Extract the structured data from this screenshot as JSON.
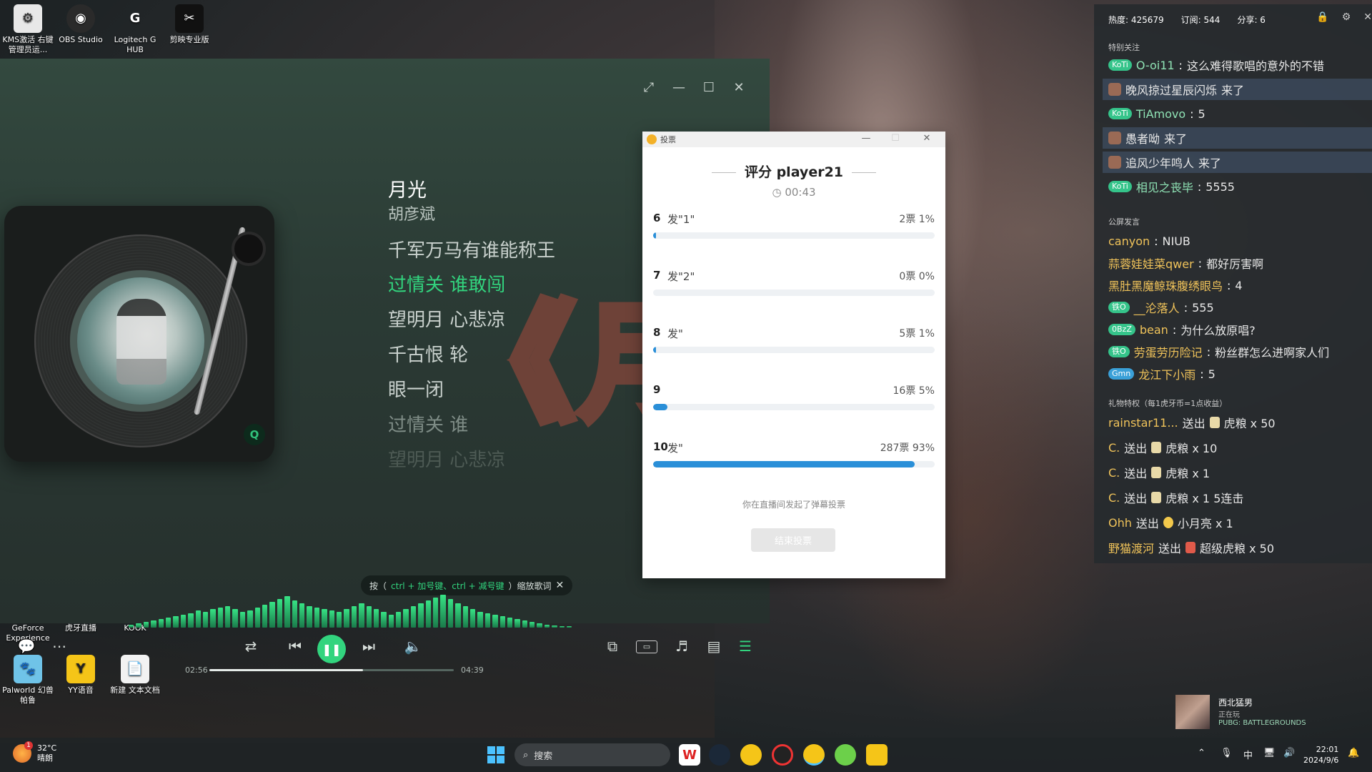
{
  "desktop_icons": [
    {
      "label": "KMS激活 右键管理员运...",
      "glyph": "⚙"
    },
    {
      "label": "OBS Studio",
      "glyph": "◉"
    },
    {
      "label": "Logitech G HUB",
      "glyph": "G"
    },
    {
      "label": "剪映专业版",
      "glyph": "✂"
    },
    {
      "label": "GeForce Experience",
      "glyph": ""
    },
    {
      "label": "虎牙直播",
      "glyph": ""
    },
    {
      "label": "KOOK",
      "glyph": ""
    },
    {
      "label": "Palworld 幻兽帕鲁",
      "glyph": "🐾"
    },
    {
      "label": "YY语音",
      "glyph": "Y"
    },
    {
      "label": "新建 文本文档",
      "glyph": "📄"
    }
  ],
  "player": {
    "song_title": "月光",
    "artist": "胡彦斌",
    "lyrics": [
      "千军万马有谁能称王",
      "过情关 谁敢闯",
      "望明月 心悲凉",
      "千古恨 轮",
      "眼一闭",
      "过情关 谁",
      "望明月 心悲凉"
    ],
    "overlay_title": "《月光》",
    "hint": {
      "prefix": "按（",
      "keys": "ctrl + 加号键、ctrl + 减号键",
      "suffix": "）缩放歌词"
    },
    "current_time": "02:56",
    "total_time": "04:39",
    "progress": 0.63
  },
  "vote": {
    "window_title": "投票",
    "title": "评分 player21",
    "timer": "00:43",
    "options": [
      {
        "num": "6",
        "label": "发\"1\"",
        "stat": "2票 1%",
        "pct": 1
      },
      {
        "num": "7",
        "label": "发\"2\"",
        "stat": "0票 0%",
        "pct": 0
      },
      {
        "num": "8",
        "label": "发\"",
        "stat": "5票 1%",
        "pct": 1
      },
      {
        "num": "9",
        "label": "",
        "stat": "16票 5%",
        "pct": 5
      },
      {
        "num": "10",
        "label": "发\"",
        "stat": "287票 93%",
        "pct": 93
      }
    ],
    "footer": "你在直播间发起了弹幕投票",
    "end_button": "结束投票"
  },
  "live": {
    "heat": "热度: 425679",
    "subs": "订阅: 544",
    "share": "分享: 6",
    "section_special": "特别关注",
    "section_public": "公屏发言",
    "section_gift": "礼物特权（每1虎牙币=1点收益）",
    "special": [
      {
        "badge": "KoTi",
        "name": "O-oi11",
        "text": "这么难得歌唱的意外的不错",
        "hl": false
      },
      {
        "badge": "",
        "name": "晚风掠过星辰闪烁",
        "text": "来了",
        "hl": true
      },
      {
        "badge": "KoTi",
        "name": "TiAmovo",
        "text": "5",
        "hl": false
      },
      {
        "badge": "",
        "name": "愚者呦",
        "text": "来了",
        "hl": true
      },
      {
        "badge": "",
        "name": "追风少年鸣人",
        "text": "来了",
        "hl": true
      },
      {
        "badge": "KoTi",
        "name": "相见之丧毕",
        "text": "5555",
        "hl": false
      }
    ],
    "public": [
      {
        "badge": "",
        "name": "canyon",
        "text": "NIUB"
      },
      {
        "badge": "",
        "name": "蒜蓉娃娃菜qwer",
        "text": "都好厉害啊"
      },
      {
        "badge": "",
        "name": "黑肚黑魔鲸珠腹绣眼鸟",
        "text": "4"
      },
      {
        "badge": "铁O",
        "name": "__沦落人",
        "text": "555"
      },
      {
        "badge": "0BzZ",
        "name": "bean",
        "text": "为什么放原唱?"
      },
      {
        "badge": "铁O",
        "name": "劳蛋劳历险记",
        "text": "粉丝群怎么进啊家人们"
      },
      {
        "badge": "Gmn",
        "name": "龙江下小雨",
        "text": "5"
      }
    ],
    "gifts": [
      {
        "name": "rainstar11...",
        "verb": "送出",
        "gift": "虎粮 x 50"
      },
      {
        "name": "C.",
        "verb": "送出",
        "gift": "虎粮 x 10"
      },
      {
        "name": "C.",
        "verb": "送出",
        "gift": "虎粮 x 1"
      },
      {
        "name": "C.",
        "verb": "送出",
        "gift": "虎粮 x 1 5连击"
      },
      {
        "name": "Ohh",
        "verb": "送出",
        "gift": "小月亮 x 1"
      },
      {
        "name": "野猫渡河",
        "verb": "送出",
        "gift": "超级虎粮 x 50"
      }
    ]
  },
  "streamer": {
    "name": "西北猛男",
    "status": "正在玩",
    "game": "PUBG: BATTLEGROUNDS"
  },
  "taskbar": {
    "temp": "32°C",
    "weather": "晴朗",
    "notif": "1",
    "search_placeholder": "搜索",
    "lang": "中",
    "time": "22:01",
    "date": "2024/9/6"
  },
  "colors": {
    "accent_green": "#32d47e",
    "vote_bar": "#2a8fd8",
    "live_badge": "#35c48a"
  }
}
